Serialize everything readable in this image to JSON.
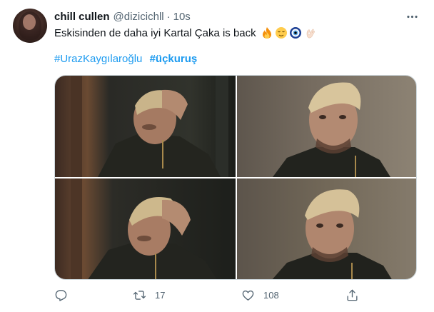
{
  "tweet": {
    "author_name": "chill cullen",
    "author_handle": "@dizicichll",
    "separator": "·",
    "time": "10s",
    "text": "Eskisinden de daha iyi Kartal Çaka is back",
    "emojis": [
      "fire-emoji",
      "relieved-face-emoji",
      "nazar-amulet-emoji",
      "ok-hand-emoji"
    ],
    "hashtags": [
      {
        "text": "#UrazKaygılaroğlu",
        "bold": false
      },
      {
        "text": "#üçkuruş",
        "bold": true
      }
    ],
    "media_count": 4,
    "replies": "",
    "retweets": "17",
    "likes": "108"
  },
  "icons": {
    "more": "more-horizontal-icon",
    "reply": "reply-icon",
    "retweet": "retweet-icon",
    "like": "heart-icon",
    "share": "share-icon"
  },
  "colors": {
    "link": "#1d9bf0",
    "muted": "#536471",
    "text": "#0f1419",
    "border": "#cfd9de"
  }
}
